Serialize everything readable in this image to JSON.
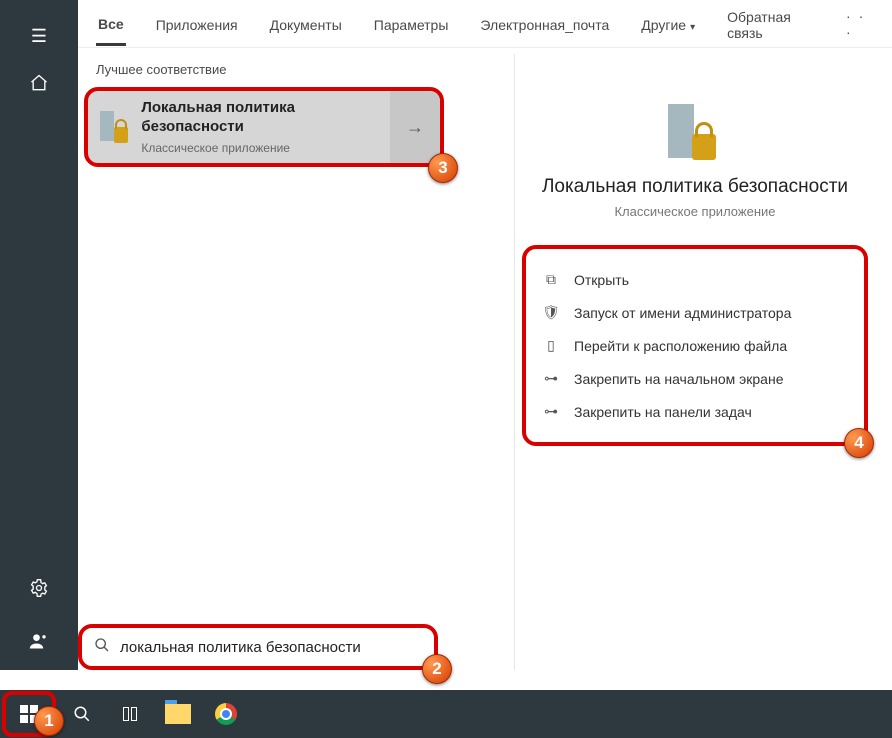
{
  "tabs": {
    "all": "Все",
    "apps": "Приложения",
    "docs": "Документы",
    "settings": "Параметры",
    "email": "Электронная_почта",
    "other": "Другие",
    "feedback": "Обратная связь"
  },
  "section_label": "Лучшее соответствие",
  "result": {
    "title": "Локальная политика безопасности",
    "subtitle": "Классическое приложение"
  },
  "detail": {
    "title": "Локальная политика безопасности",
    "subtitle": "Классическое приложение"
  },
  "actions": {
    "open": "Открыть",
    "run_admin": "Запуск от имени администратора",
    "file_location": "Перейти к расположению файла",
    "pin_start": "Закрепить на начальном экране",
    "pin_taskbar": "Закрепить на панели задач"
  },
  "search": {
    "value": "локальная политика безопасности"
  },
  "badges": {
    "b1": "1",
    "b2": "2",
    "b3": "3",
    "b4": "4"
  }
}
